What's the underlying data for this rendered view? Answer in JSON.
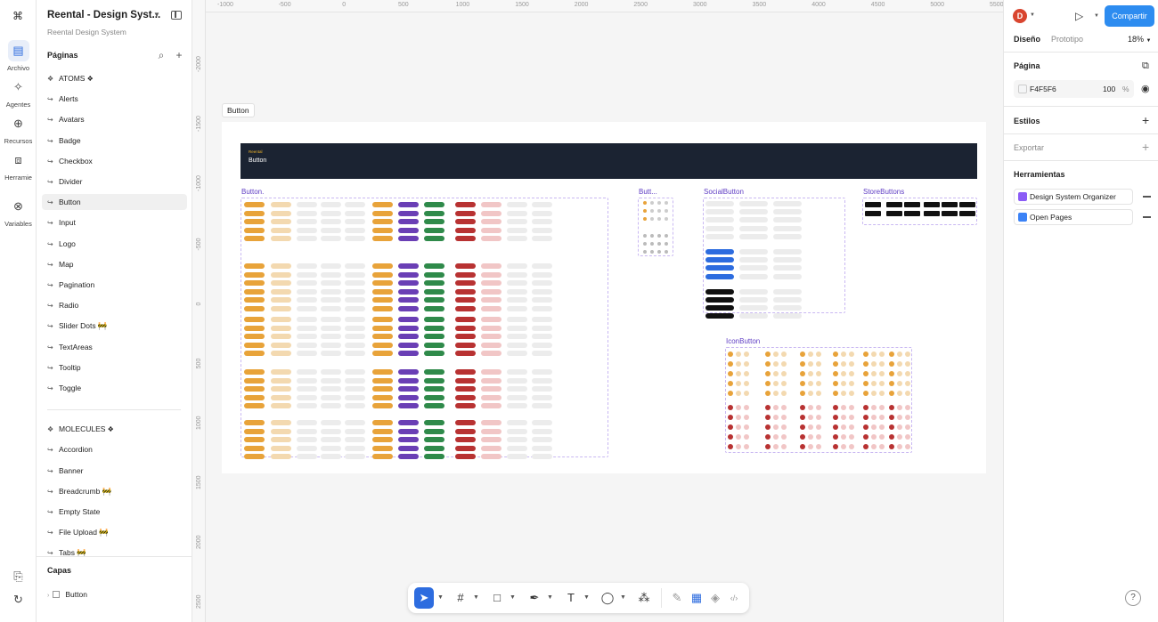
{
  "rail": {
    "items": [
      {
        "label": "Archivo",
        "icon": "file-icon"
      },
      {
        "label": "Agentes",
        "icon": "sparkle-icon"
      },
      {
        "label": "Recursos",
        "icon": "plus-circle-icon"
      },
      {
        "label": "Herramie",
        "icon": "toolbox-icon"
      },
      {
        "label": "Variables",
        "icon": "variables-icon"
      }
    ]
  },
  "file": {
    "title": "Reental - Design Syst...",
    "subtitle": "Reental Design System"
  },
  "pages": {
    "header": "Páginas",
    "items": [
      {
        "label": "ATOMS",
        "kind": "section"
      },
      {
        "label": "Alerts",
        "kind": "page"
      },
      {
        "label": "Avatars",
        "kind": "page"
      },
      {
        "label": "Badge",
        "kind": "page"
      },
      {
        "label": "Checkbox",
        "kind": "page"
      },
      {
        "label": "Divider",
        "kind": "page"
      },
      {
        "label": "Button",
        "kind": "page",
        "selected": true
      },
      {
        "label": "Input",
        "kind": "page"
      },
      {
        "label": "Logo",
        "kind": "page"
      },
      {
        "label": "Map",
        "kind": "page"
      },
      {
        "label": "Pagination",
        "kind": "page"
      },
      {
        "label": "Radio",
        "kind": "page"
      },
      {
        "label": "Slider Dots 🚧",
        "kind": "page"
      },
      {
        "label": "TextAreas",
        "kind": "page"
      },
      {
        "label": "Tooltip",
        "kind": "page"
      },
      {
        "label": "Toggle",
        "kind": "page"
      },
      {
        "label": "MOLECULES",
        "kind": "section"
      },
      {
        "label": "Accordion",
        "kind": "page"
      },
      {
        "label": "Banner",
        "kind": "page"
      },
      {
        "label": "Breadcrumb 🚧",
        "kind": "page"
      },
      {
        "label": "Empty State",
        "kind": "page"
      },
      {
        "label": "File Upload 🚧",
        "kind": "page"
      },
      {
        "label": "Tabs 🚧",
        "kind": "page"
      }
    ]
  },
  "layers": {
    "header": "Capas",
    "items": [
      {
        "label": "Button"
      }
    ]
  },
  "canvas": {
    "ruler_x": [
      "-1000",
      "-500",
      "0",
      "500",
      "1000",
      "1500",
      "2000",
      "2500",
      "3000",
      "3500",
      "4000",
      "4500",
      "5000",
      "5500"
    ],
    "ruler_y": [
      "-2000",
      "-1500",
      "-1000",
      "-500",
      "0",
      "500",
      "1000",
      "1500",
      "2000",
      "2500"
    ],
    "frame_label": "Button",
    "banner": {
      "brand": "Reental",
      "title": "Button"
    },
    "components": [
      "Button.",
      "Butt...",
      "SocialButton",
      "StoreButtons",
      "IconButton"
    ]
  },
  "toolbar": {
    "tools": [
      {
        "name": "move-tool",
        "glyph": "➤",
        "active": true
      },
      {
        "name": "frame-tool",
        "glyph": "#"
      },
      {
        "name": "rectangle-tool",
        "glyph": "□"
      },
      {
        "name": "pen-tool",
        "glyph": "✒"
      },
      {
        "name": "text-tool",
        "glyph": "T"
      },
      {
        "name": "comment-tool",
        "glyph": "◯"
      },
      {
        "name": "actions-tool",
        "glyph": "⁂"
      },
      {
        "name": "draw-tool",
        "glyph": "✎"
      },
      {
        "name": "design-tool",
        "glyph": "▦"
      },
      {
        "name": "component-tool",
        "glyph": "◈"
      },
      {
        "name": "code-tool",
        "glyph": "‹/›"
      }
    ]
  },
  "right": {
    "avatar_letter": "D",
    "share_label": "Compartir",
    "tabs": [
      "Diseño",
      "Prototipo"
    ],
    "zoom": "18%",
    "page_section": "Página",
    "bg_hex": "F4F5F6",
    "bg_opacity": "100",
    "bg_pct": "%",
    "styles": "Estilos",
    "export": "Exportar",
    "tools": "Herramientas",
    "plugins": [
      {
        "label": "Design System Organizer",
        "color": "#8b5cf6"
      },
      {
        "label": "Open Pages",
        "color": "#3b82f6"
      }
    ],
    "help": "?"
  },
  "colors": {
    "accent": "#2d8cf0",
    "component": "#5f3dc4",
    "banner": "#1b2332"
  }
}
